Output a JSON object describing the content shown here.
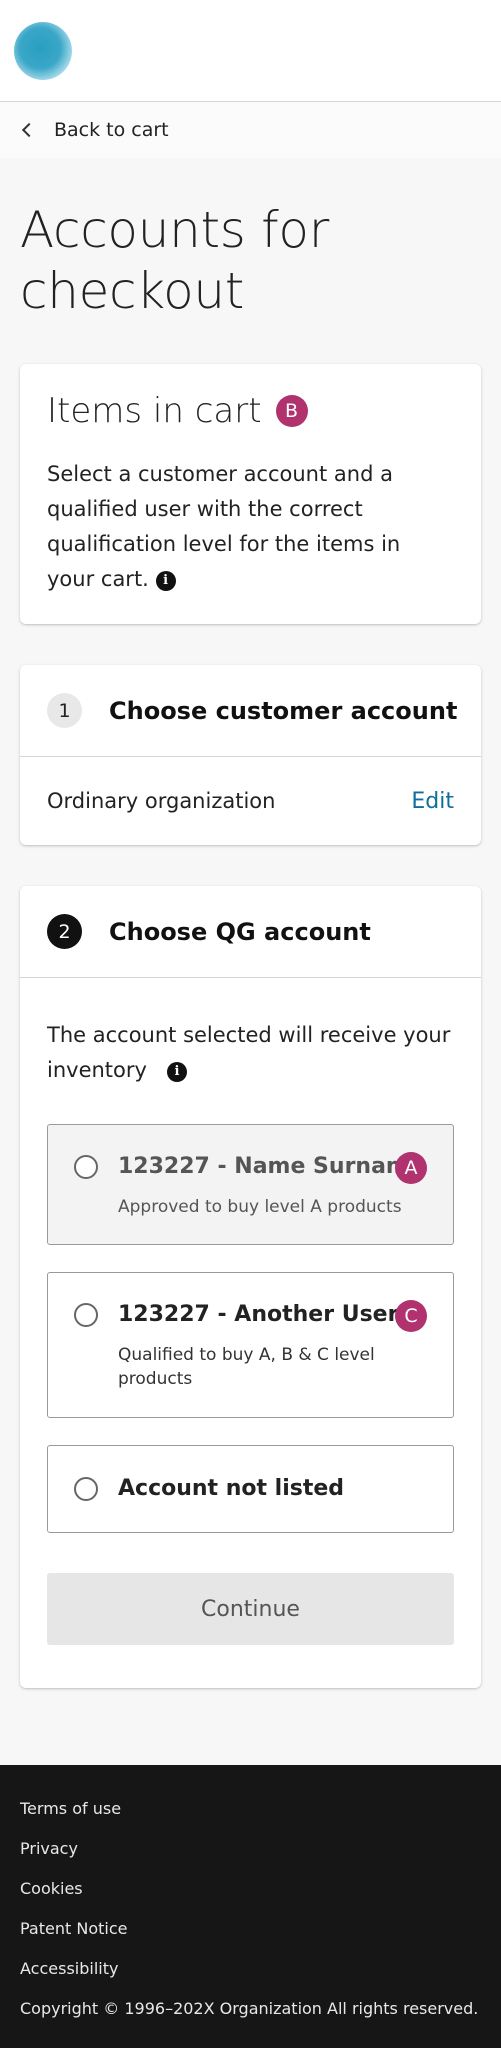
{
  "header": {
    "logo": "organization-logo"
  },
  "nav": {
    "back_label": "Back to cart"
  },
  "page": {
    "title_line1": "Accounts for",
    "title_line2": "checkout"
  },
  "cart": {
    "title": "Items in cart",
    "badge": "B",
    "description": "Select a customer account and a qualified user with the correct qualification level for the items in your cart."
  },
  "step1": {
    "number": "1",
    "title": "Choose customer account",
    "selected_account": "Ordinary organization",
    "edit_label": "Edit"
  },
  "step2": {
    "number": "2",
    "title": "Choose QG account",
    "description": "The account selected will receive your inventory",
    "options": [
      {
        "title": "123227 - Name Surname",
        "subtitle": "Approved to buy level A products",
        "badge": "A",
        "selected": false
      },
      {
        "title": "123227 - Another User",
        "subtitle": "Qualified to buy A, B & C level products",
        "badge": "C",
        "selected": false
      },
      {
        "title": "Account not listed",
        "subtitle": "",
        "badge": "",
        "selected": false
      }
    ],
    "continue_label": "Continue"
  },
  "footer": {
    "links": [
      "Terms of use",
      "Privacy",
      "Cookies",
      "Patent Notice",
      "Accessibility"
    ],
    "copyright": "Copyright © 1996–202X Organization All rights reserved."
  },
  "colors": {
    "badge": "#b0326f",
    "link": "#0f6f9a",
    "footer_bg": "#161616",
    "logo": "#2a9ec0"
  }
}
